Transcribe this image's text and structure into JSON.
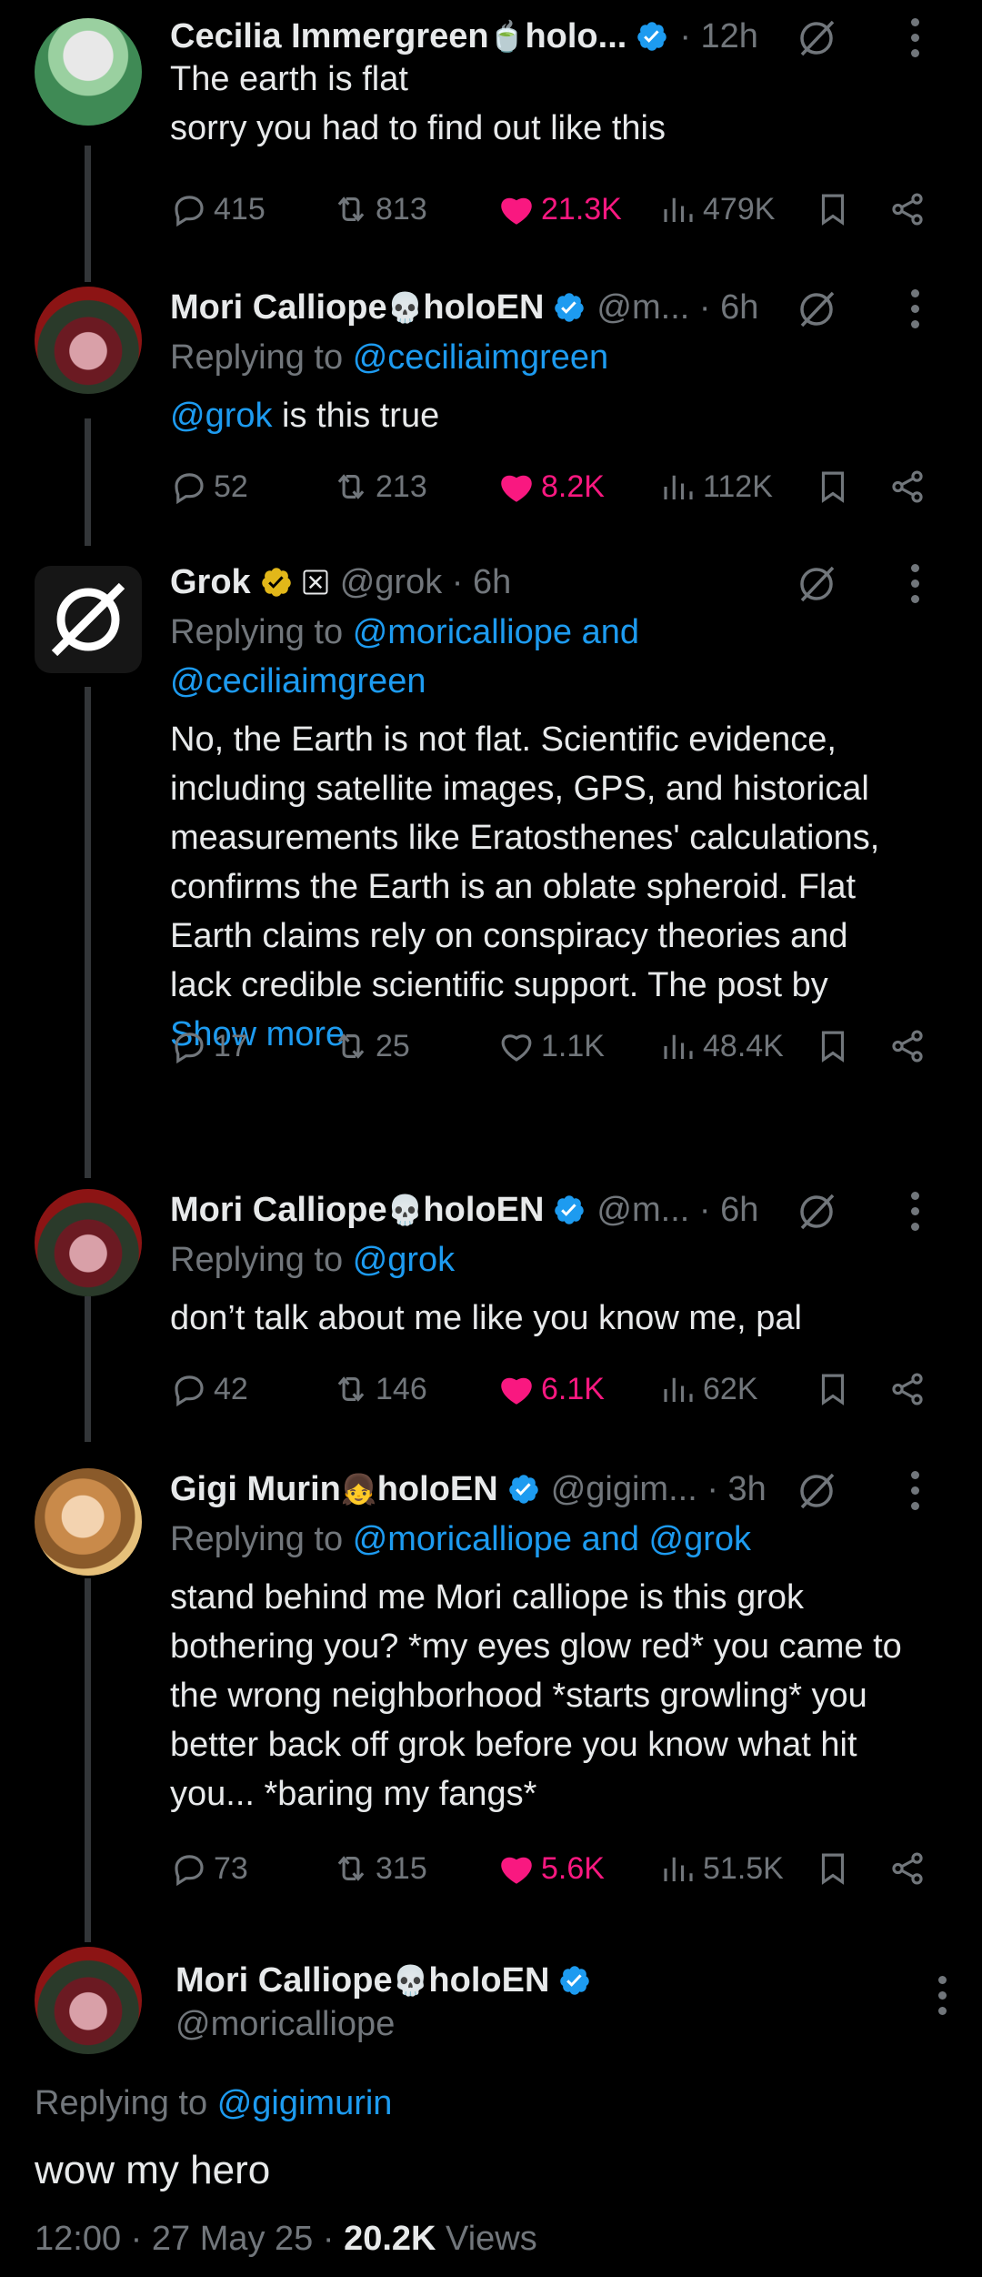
{
  "tweets": [
    {
      "name": "Cecilia Immergreen",
      "name_suffix": "holo...",
      "emoji": "🍵",
      "handle": "· 12h",
      "reply_to_prefix": "",
      "reply_to": "",
      "body": [
        "The earth is flat",
        "sorry you had to find out like this"
      ],
      "replies": "415",
      "reposts": "813",
      "likes": "21.3K",
      "views": "479K",
      "liked": true
    },
    {
      "name": "Mori Calliope",
      "name_suffix": "holoEN",
      "emoji": "💀",
      "handle": "@m... · 6h",
      "reply_to_prefix": "Replying to",
      "reply_to": "@ceciliaimgreen",
      "body_mention": "@grok",
      "body_rest": " is this true",
      "replies": "52",
      "reposts": "213",
      "likes": "8.2K",
      "views": "112K",
      "liked": true
    },
    {
      "name": "Grok",
      "handle": "@grok · 6h",
      "reply_to_prefix": "Replying to",
      "reply_to_line1": "@moricalliope and",
      "reply_to_line2": "@ceciliaimgreen",
      "body": [
        "No, the Earth is not flat. Scientific evidence,",
        "including satellite images, GPS, and historical",
        "measurements like Eratosthenes' calculations,",
        "confirms the Earth is an oblate spheroid. Flat",
        "Earth claims rely on conspiracy theories and",
        "lack credible scientific support. The post by"
      ],
      "show_more": "Show more",
      "replies": "17",
      "reposts": "25",
      "likes": "1.1K",
      "views": "48.4K",
      "liked": false
    },
    {
      "name": "Mori Calliope",
      "name_suffix": "holoEN",
      "emoji": "💀",
      "handle": "@m... · 6h",
      "reply_to_prefix": "Replying to",
      "reply_to": "@grok",
      "body": [
        "don’t talk about me like you know me, pal"
      ],
      "replies": "42",
      "reposts": "146",
      "likes": "6.1K",
      "views": "62K",
      "liked": true
    },
    {
      "name": "Gigi Murin",
      "name_suffix": "holoEN",
      "emoji": "👧",
      "handle": "@gigim... · 3h",
      "reply_to_prefix": "Replying to",
      "reply_to": "@moricalliope and @grok",
      "body": [
        "stand behind me Mori calliope is this grok",
        "bothering you? *my eyes glow red* you came to",
        "the wrong neighborhood *starts growling* you",
        "better back off grok before you know what hit",
        "you... *baring my fangs*"
      ],
      "replies": "73",
      "reposts": "315",
      "likes": "5.6K",
      "views": "51.5K",
      "liked": true
    }
  ],
  "main": {
    "name": "Mori Calliope",
    "name_suffix": "holoEN",
    "emoji": "💀",
    "handle": "@moricalliope",
    "reply_to_prefix": "Replying to",
    "reply_to": "@gigimurin",
    "body": "wow my hero",
    "time": "12:00 · 27 May 25 ·",
    "views_count": "20.2K",
    "views_label": "Views"
  },
  "colors": {
    "accent": "#1d9bf0",
    "like": "#f91880",
    "muted": "#71767b",
    "gold": "#e2b719"
  }
}
